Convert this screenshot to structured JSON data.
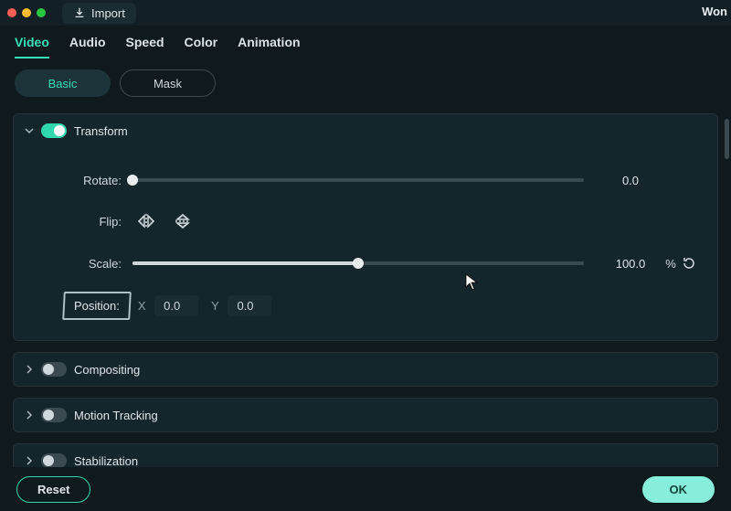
{
  "titlebar": {
    "import_label": "Import",
    "app_name_partial": "Won"
  },
  "tabs": [
    "Video",
    "Audio",
    "Speed",
    "Color",
    "Animation"
  ],
  "active_tab_index": 0,
  "subtabs": {
    "basic": "Basic",
    "mask": "Mask"
  },
  "transform": {
    "title": "Transform",
    "enabled": true,
    "expanded": true,
    "rotate": {
      "label": "Rotate:",
      "value": "0.0",
      "fill_pct": 0
    },
    "flip": {
      "label": "Flip:"
    },
    "scale": {
      "label": "Scale:",
      "value": "100.0",
      "unit": "%",
      "fill_pct": 50
    },
    "position": {
      "label": "Position:",
      "x_label": "X",
      "x_value": "0.0",
      "y_label": "Y",
      "y_value": "0.0"
    }
  },
  "compositing": {
    "title": "Compositing",
    "enabled": false,
    "expanded": false
  },
  "motion_tracking": {
    "title": "Motion Tracking",
    "enabled": false,
    "expanded": false
  },
  "stabilization": {
    "title": "Stabilization",
    "enabled": false,
    "expanded": false
  },
  "footer": {
    "reset": "Reset",
    "ok": "OK"
  },
  "icons": {
    "import": "import-icon",
    "flip_h": "flip-horizontal-icon",
    "flip_v": "flip-vertical-icon",
    "reset_circle": "reset-icon"
  }
}
